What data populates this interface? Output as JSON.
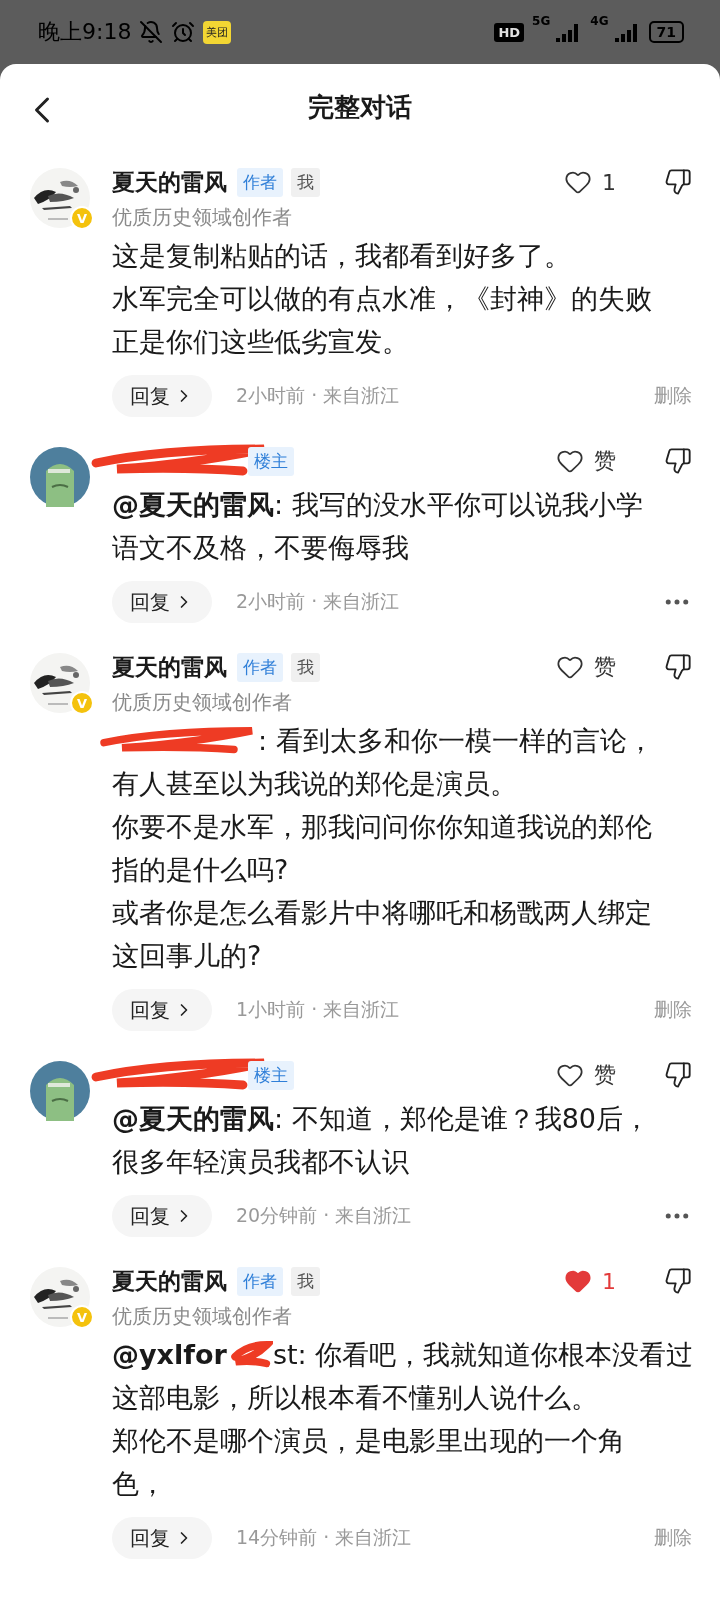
{
  "status_bar": {
    "time": "晚上9:18",
    "app_badge": "美团",
    "hd": "HD",
    "network_1": "5G",
    "network_2": "4G",
    "battery": "71"
  },
  "header": {
    "title": "完整对话"
  },
  "comments": [
    {
      "avatar": {
        "kind": "ink"
      },
      "verified": "V",
      "author": "夏天的雷风",
      "author_redacted": false,
      "badges": [
        {
          "kind": "author",
          "text": "作者"
        },
        {
          "kind": "me",
          "text": "我"
        }
      ],
      "subtitle": "优质历史领域创作者",
      "like": {
        "liked": false,
        "label": "1"
      },
      "paragraphs": [
        "这是复制粘贴的话，我都看到好多了。",
        "水军完全可以做的有点水准，《封神》的失败正是你们这些低劣宣发。"
      ],
      "reply": "回复",
      "meta": "2小时前 · 来自浙江",
      "action": {
        "kind": "delete",
        "label": "删除"
      }
    },
    {
      "avatar": {
        "kind": "green"
      },
      "author_redacted": true,
      "badges": [
        {
          "kind": "op",
          "text": "楼主"
        }
      ],
      "like": {
        "liked": false,
        "label": "赞"
      },
      "mention": "@夏天的雷风",
      "paragraphs": [
        ": 我写的没水平你可以说我小学语文不及格，不要侮辱我"
      ],
      "reply": "回复",
      "meta": "2小时前 · 来自浙江",
      "action": {
        "kind": "more"
      }
    },
    {
      "avatar": {
        "kind": "ink"
      },
      "verified": "V",
      "author": "夏天的雷风",
      "author_redacted": false,
      "badges": [
        {
          "kind": "author",
          "text": "作者"
        },
        {
          "kind": "me",
          "text": "我"
        }
      ],
      "subtitle": "优质历史领域创作者",
      "like": {
        "liked": false,
        "label": "赞"
      },
      "lead": {
        "after": ": 看到太多和你一模一样的言论，"
      },
      "paragraphs": [
        "有人甚至以为我说的郑伦是演员。",
        "你要不是水军，那我问问你你知道我说的郑伦指的是什么吗?",
        "或者你是怎么看影片中将哪吒和杨戬两人绑定这回事儿的?"
      ],
      "reply": "回复",
      "meta": "1小时前 · 来自浙江",
      "action": {
        "kind": "delete",
        "label": "删除"
      }
    },
    {
      "avatar": {
        "kind": "green"
      },
      "author_redacted": true,
      "badges": [
        {
          "kind": "op",
          "text": "楼主"
        }
      ],
      "like": {
        "liked": false,
        "label": "赞"
      },
      "mention": "@夏天的雷风",
      "paragraphs": [
        ": 不知道，郑伦是谁？我80后，很多年轻演员我都不认识"
      ],
      "reply": "回复",
      "meta": "20分钟前 · 来自浙江",
      "action": {
        "kind": "more"
      }
    },
    {
      "avatar": {
        "kind": "ink"
      },
      "verified": "V",
      "author": "夏天的雷风",
      "author_redacted": false,
      "badges": [
        {
          "kind": "author",
          "text": "作者"
        },
        {
          "kind": "me",
          "text": "我"
        }
      ],
      "subtitle": "优质历史领域创作者",
      "like": {
        "liked": true,
        "label": "1"
      },
      "lead": {
        "before": "@yxlfor",
        "after": "st: 你看吧，我就知道你根本没看过"
      },
      "paragraphs": [
        "这部电影，所以根本看不懂别人说什么。",
        "郑伦不是哪个演员，是电影里出现的一个角色，"
      ],
      "reply": "回复",
      "meta": "14分钟前 · 来自浙江",
      "action": {
        "kind": "delete",
        "label": "删除"
      }
    }
  ]
}
